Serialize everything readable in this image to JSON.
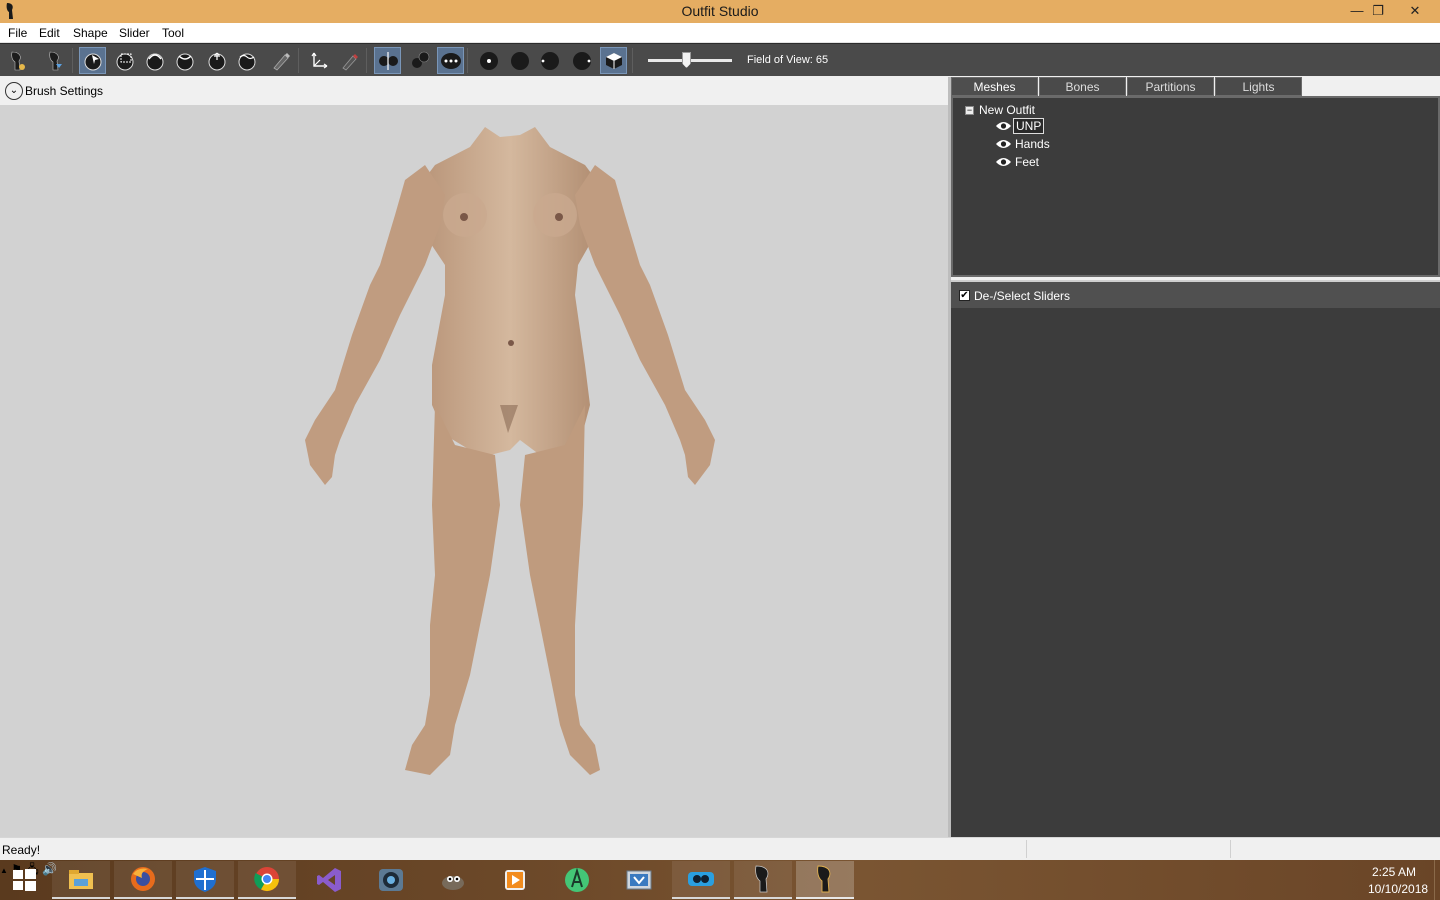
{
  "window": {
    "title": "Outfit Studio",
    "minimize_glyph": "—",
    "restore_glyph": "❐",
    "close_glyph": "✕"
  },
  "menu": {
    "items": [
      "File",
      "Edit",
      "Shape",
      "Slider",
      "Tool"
    ]
  },
  "toolbar": {
    "tools": [
      {
        "name": "new-project-icon",
        "active": false
      },
      {
        "name": "load-project-icon",
        "active": false
      },
      {
        "name": "select-brush-icon",
        "active": true
      },
      {
        "name": "mask-brush-icon",
        "active": false
      },
      {
        "name": "inflate-brush-icon",
        "active": false
      },
      {
        "name": "deflate-brush-icon",
        "active": false
      },
      {
        "name": "move-brush-icon",
        "active": false
      },
      {
        "name": "smooth-brush-icon",
        "active": false
      },
      {
        "name": "weight-brush-icon",
        "active": false
      },
      {
        "name": "transform-icon",
        "active": false
      },
      {
        "name": "pencil-icon",
        "active": false
      },
      {
        "name": "x-mirror-icon",
        "active": true
      },
      {
        "name": "connected-only-icon",
        "active": false
      },
      {
        "name": "global-brush-icon",
        "active": true
      },
      {
        "name": "vertex-view-icon",
        "active": false
      },
      {
        "name": "wireframe-view-icon",
        "active": false
      },
      {
        "name": "lighting-view-icon",
        "active": false
      },
      {
        "name": "texture-view-icon",
        "active": false
      },
      {
        "name": "cube-view-icon",
        "active": true
      }
    ],
    "fov_label": "Field of View: 65",
    "fov_value": 65
  },
  "brush_settings": {
    "label": "Brush Settings",
    "chevron": "⌄"
  },
  "right_pane": {
    "tabs": [
      "Meshes",
      "Bones",
      "Partitions",
      "Lights"
    ],
    "active_tab": "Meshes",
    "tree": {
      "toggle_glyph": "−",
      "root": "New Outfit",
      "meshes": [
        {
          "label": "UNP",
          "selected": true
        },
        {
          "label": "Hands",
          "selected": false
        },
        {
          "label": "Feet",
          "selected": false
        }
      ]
    },
    "sliders": {
      "checkbox_glyph": "✔",
      "label": "De-/Select Sliders",
      "checked": true
    }
  },
  "status": {
    "text": "Ready!"
  },
  "taskbar": {
    "apps": [
      {
        "name": "start-icon",
        "state": "none"
      },
      {
        "name": "file-explorer-icon",
        "state": "pinned"
      },
      {
        "name": "firefox-icon",
        "state": "pinned"
      },
      {
        "name": "windows-defender-icon",
        "state": "pinned"
      },
      {
        "name": "chrome-icon",
        "state": "pinned"
      },
      {
        "name": "visual-studio-icon",
        "state": "none"
      },
      {
        "name": "camera-app-icon",
        "state": "none"
      },
      {
        "name": "gimp-icon",
        "state": "none"
      },
      {
        "name": "media-player-icon",
        "state": "none"
      },
      {
        "name": "android-studio-icon",
        "state": "none"
      },
      {
        "name": "virtual-machine-icon",
        "state": "none"
      },
      {
        "name": "cloud-app-icon",
        "state": "pinned"
      },
      {
        "name": "outfit-studio-icon",
        "state": "pinned"
      },
      {
        "name": "outfit-studio-window-icon",
        "state": "active"
      }
    ],
    "tray": {
      "up_arrow": "▲",
      "flag": "⚑",
      "network": "🖧",
      "volume": "🔊"
    },
    "time": "2:25 AM",
    "date": "10/10/2018"
  },
  "colors": {
    "titlebar": "#e5ad62",
    "toolbar": "#4a4a4a",
    "viewport": "#d2d2d2",
    "panel_dark": "#3c3c3c",
    "active_tool": "#5a7290",
    "skin": "#c8a88c"
  }
}
